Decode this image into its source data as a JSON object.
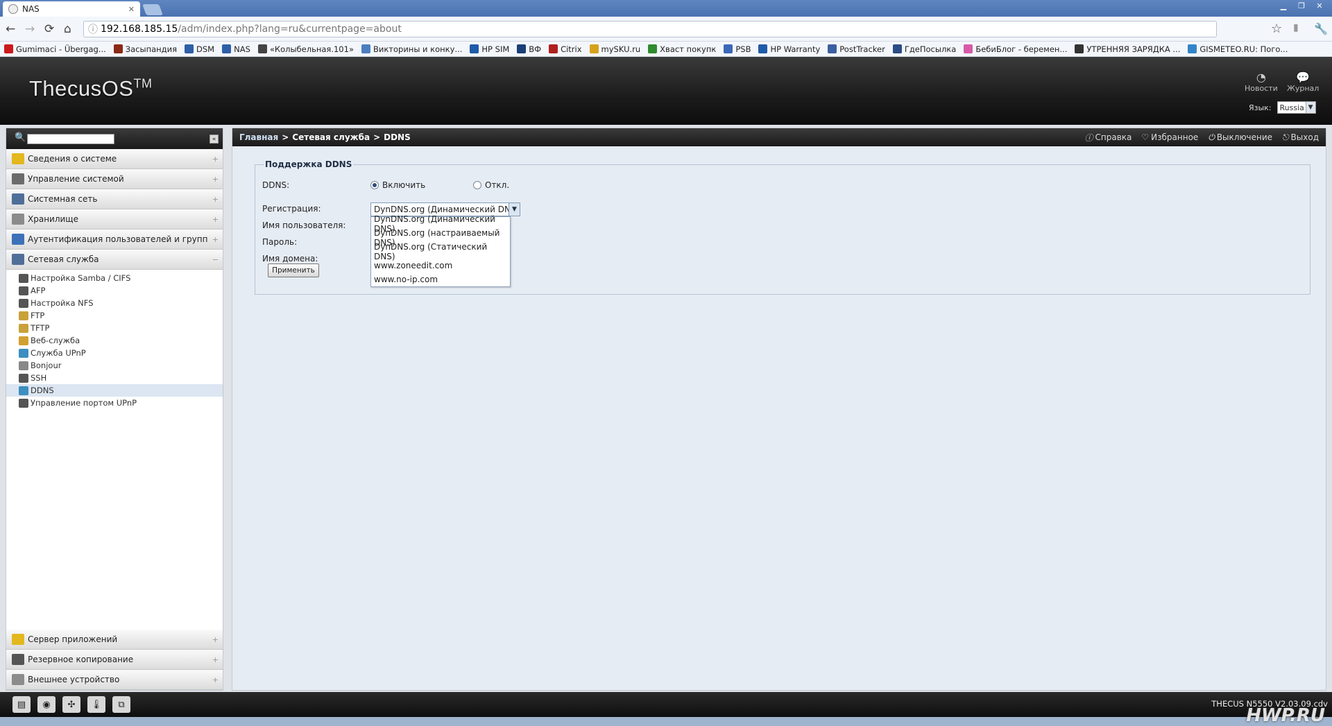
{
  "browser": {
    "tab_title": "NAS",
    "url_host": "192.168.185.15",
    "url_path": "/adm/index.php?lang=ru&currentpage=about",
    "bookmarks": [
      {
        "label": "Gumimaci - Übergag...",
        "color": "#cc1a1a"
      },
      {
        "label": "Засыпандия",
        "color": "#8b2a16"
      },
      {
        "label": "DSM",
        "color": "#2e5fa8"
      },
      {
        "label": "NAS",
        "color": "#2e5fa8"
      },
      {
        "label": "«Колыбельная.101»",
        "color": "#444444"
      },
      {
        "label": "Викторины и конку...",
        "color": "#4a7fc0"
      },
      {
        "label": "HP SIM",
        "color": "#1f5ba8"
      },
      {
        "label": "ВФ",
        "color": "#1b3f77"
      },
      {
        "label": "Citrix",
        "color": "#b01f1f"
      },
      {
        "label": "mySKU.ru",
        "color": "#d6a21c"
      },
      {
        "label": "Хваст покупк",
        "color": "#2e8b2e"
      },
      {
        "label": "PSB",
        "color": "#3a68b8"
      },
      {
        "label": "HP Warranty",
        "color": "#1f5ba8"
      },
      {
        "label": "PostTracker",
        "color": "#3b5fa0"
      },
      {
        "label": "ГдеПосылка",
        "color": "#2b4c84"
      },
      {
        "label": "БебиБлог - беремен...",
        "color": "#d65aa8"
      },
      {
        "label": "УТРЕННЯЯ ЗАРЯДКА ...",
        "color": "#333333"
      },
      {
        "label": "GISMETEO.RU: Пого...",
        "color": "#3384c9"
      }
    ]
  },
  "header": {
    "logo": "ThecusOS",
    "logo_tm": "TM",
    "news_label": "Новости",
    "log_label": "Журнал",
    "lang_label": "Язык:",
    "lang_value": "Russia"
  },
  "sidebar": {
    "groups_top": [
      {
        "label": "Сведения о системе",
        "color": "#e3b71e",
        "sign": "+"
      },
      {
        "label": "Управление системой",
        "color": "#6b6b6b",
        "sign": "+"
      },
      {
        "label": "Системная сеть",
        "color": "#4f6f98",
        "sign": "+"
      },
      {
        "label": "Хранилище",
        "color": "#8c8c8c",
        "sign": "+"
      },
      {
        "label": "Аутентификация пользователей и групп",
        "color": "#3d72b8",
        "sign": "+"
      },
      {
        "label": "Сетевая служба",
        "color": "#4f6f98",
        "sign": "−"
      }
    ],
    "subitems": [
      {
        "label": "Настройка Samba / CIFS",
        "color": "#555555"
      },
      {
        "label": "AFP",
        "color": "#555555"
      },
      {
        "label": "Настройка NFS",
        "color": "#555555"
      },
      {
        "label": "FTP",
        "color": "#c9a13a"
      },
      {
        "label": "TFTP",
        "color": "#c9a13a"
      },
      {
        "label": "Веб-служба",
        "color": "#d2a030"
      },
      {
        "label": "Служба UPnP",
        "color": "#3c8fc0"
      },
      {
        "label": "Bonjour",
        "color": "#888888"
      },
      {
        "label": "SSH",
        "color": "#555555"
      },
      {
        "label": "DDNS",
        "color": "#3c8fc0"
      },
      {
        "label": "Управление портом UPnP",
        "color": "#555555"
      }
    ],
    "active_index": 9,
    "groups_bottom": [
      {
        "label": "Сервер приложений",
        "color": "#e3b71e",
        "sign": "+"
      },
      {
        "label": "Резервное копирование",
        "color": "#555555",
        "sign": "+"
      },
      {
        "label": "Внешнее устройство",
        "color": "#8c8c8c",
        "sign": "+"
      }
    ]
  },
  "breadcrumb": {
    "home": "Главная",
    "sep": ">",
    "section": "Сетевая служба",
    "page": "DDNS"
  },
  "toolbar": {
    "help": "Справка",
    "favorites": "Избранное",
    "shutdown": "Выключение",
    "logout": "Выход"
  },
  "form": {
    "legend": "Поддержка DDNS",
    "ddns_label": "DDNS:",
    "enable_label": "Включить",
    "disable_label": "Откл.",
    "enabled": true,
    "reg_label": "Регистрация:",
    "reg_value": "DynDNS.org (Динамический DNS)",
    "user_label": "Имя пользователя:",
    "pass_label": "Пароль:",
    "domain_label": "Имя домена:",
    "apply_label": "Применить",
    "options": [
      "DynDNS.org (Динамический DNS)",
      "DynDNS.org (настраиваемый DNS)",
      "DynDNS.org (Статический DNS)",
      "www.zoneedit.com",
      "www.no-ip.com"
    ]
  },
  "footer": {
    "version": "THECUS N5550 V2.03.09.cdv",
    "watermark": "HWP.RU"
  }
}
